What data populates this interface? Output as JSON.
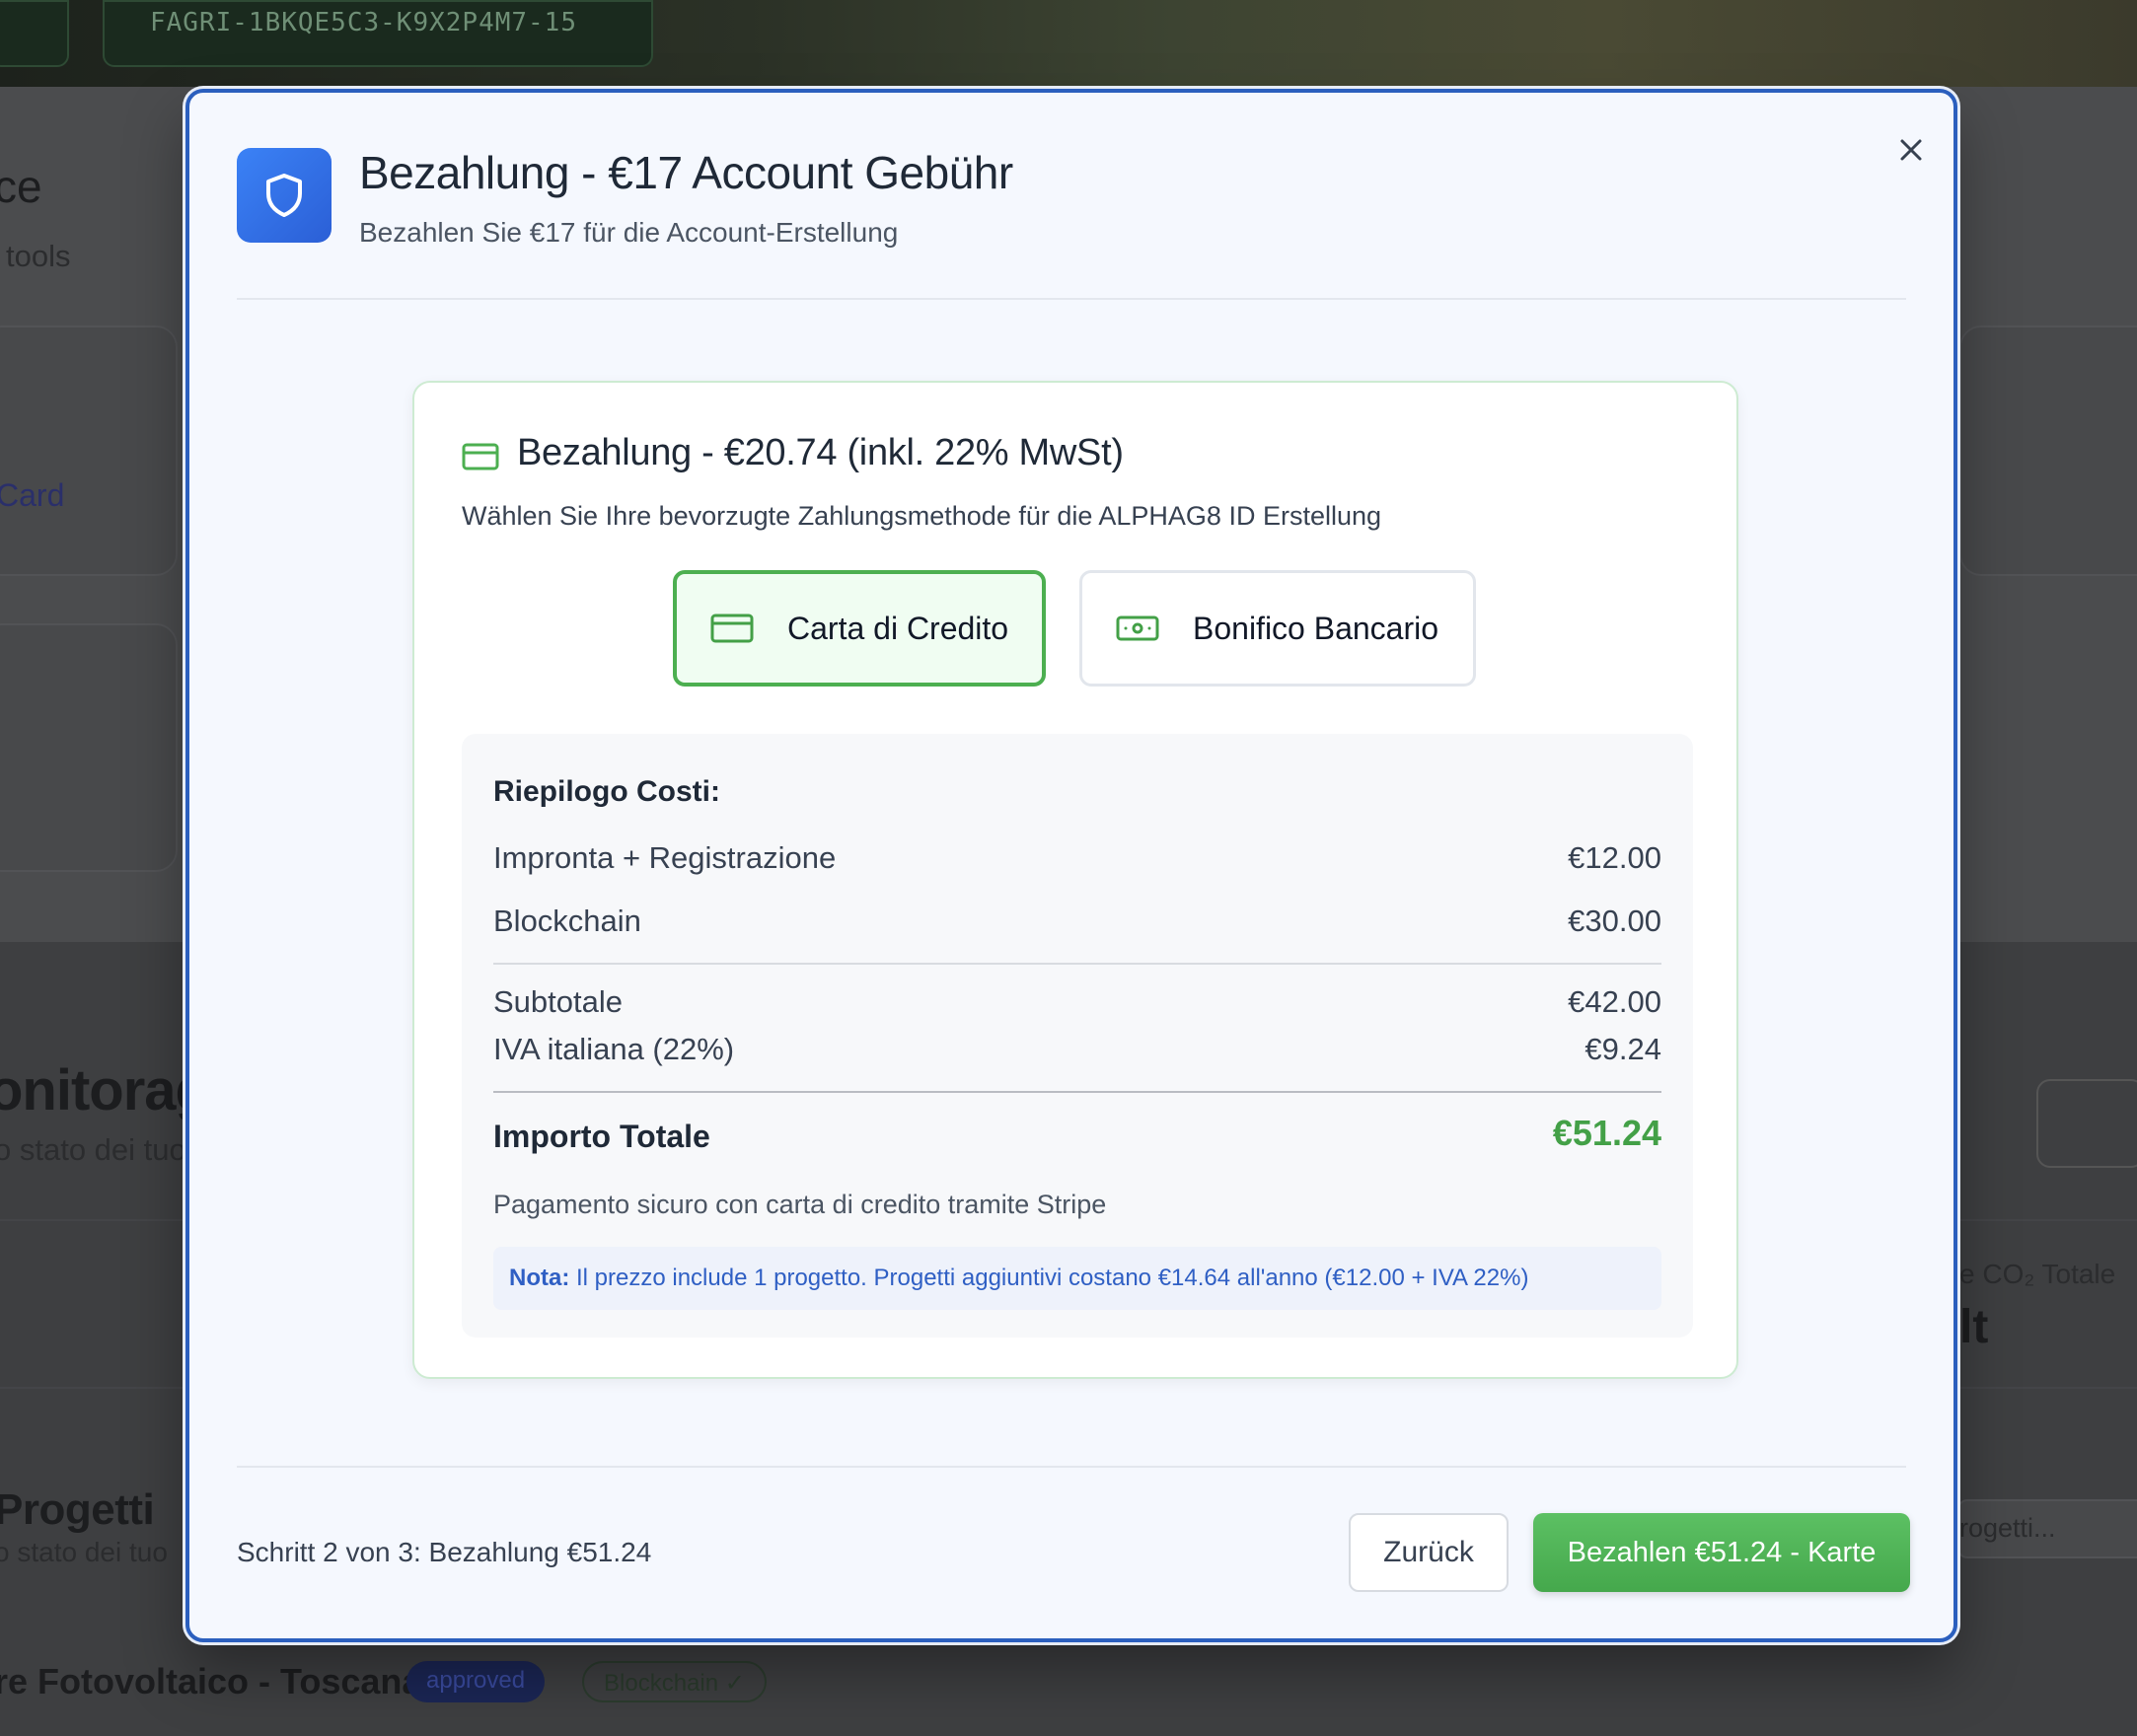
{
  "background": {
    "topbar_code": "FAGRI-1BKQE5C3-K9X2P4M7-15",
    "frag_ce": "ce",
    "frag_tools": "tools",
    "frag_card": "Card",
    "frag_monitorag": "onitorag",
    "frag_stato1": "o stato dei tuo",
    "frag_co2": "e CO₂ Totale",
    "frag_t": "lt",
    "frag_progetti": "Progetti",
    "frag_stato2": "o stato dei tuo",
    "frag_search": "rogetti...",
    "frag_project": "re Fotovoltaico - Toscana",
    "badge_approved": "approved",
    "badge_blockchain": "Blockchain ✓"
  },
  "modal": {
    "title": "Bezahlung - €17 Account Gebühr",
    "subtitle": "Bezahlen Sie €17 für die Account-Erstellung",
    "header_icon": "shield-icon",
    "close_icon": "close-icon",
    "payment": {
      "title": "Bezahlung - €20.74 (inkl. 22% MwSt)",
      "description": "Wählen Sie Ihre bevorzugte Zahlungsmethode für die ALPHAG8 ID Erstellung",
      "methods": [
        {
          "label": "Carta di Credito",
          "icon": "credit-card-icon",
          "selected": true
        },
        {
          "label": "Bonifico Bancario",
          "icon": "banknote-icon",
          "selected": false
        }
      ],
      "summary": {
        "title": "Riepilogo Costi:",
        "items": [
          {
            "label": "Impronta + Registrazione",
            "value": "€12.00"
          },
          {
            "label": "Blockchain",
            "value": "€30.00"
          }
        ],
        "subtotal_label": "Subtotale",
        "subtotal_value": "€42.00",
        "vat_label": "IVA italiana (22%)",
        "vat_value": "€9.24",
        "total_label": "Importo Totale",
        "total_value": "€51.24",
        "secure_note": "Pagamento sicuro con carta di credito tramite Stripe",
        "nota_label": "Nota:",
        "nota_text": "Il prezzo include 1 progetto. Progetti aggiuntivi costano €14.64 all'anno (€12.00 + IVA 22%)"
      }
    },
    "footer": {
      "step": "Schritt 2 von 3: Bezahlung €51.24",
      "back": "Zurück",
      "pay": "Bezahlen €51.24 - Karte"
    }
  },
  "colors": {
    "accent_blue": "#2b5fbe",
    "success_green": "#4caf50",
    "total_green": "#43a047",
    "nota_blue": "#2f5fc4"
  }
}
